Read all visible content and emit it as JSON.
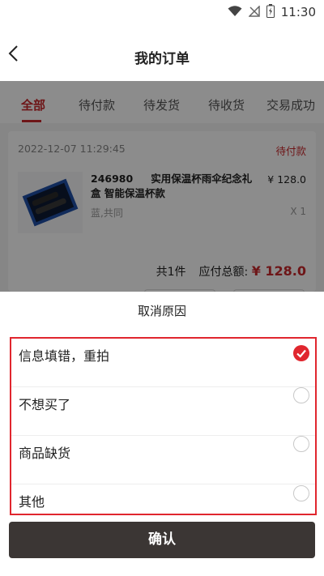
{
  "status_bar": {
    "time": "11:30",
    "icons": [
      "wifi-icon",
      "signal-off-icon",
      "battery-charging-icon"
    ]
  },
  "header": {
    "back_icon": "chevron-left-icon",
    "title": "我的订单"
  },
  "tabs": [
    {
      "label": "全部",
      "active": true
    },
    {
      "label": "待付款",
      "active": false
    },
    {
      "label": "待发货",
      "active": false
    },
    {
      "label": "待收货",
      "active": false
    },
    {
      "label": "交易成功",
      "active": false
    }
  ],
  "order": {
    "time": "2022-12-07 11:29:45",
    "status": "待付款",
    "product": {
      "code": "246980",
      "name": "实用保温杯雨伞纪念礼盒 智能保温杯款",
      "price": "¥ 128.0",
      "spec": "蓝,共同",
      "qty": "X 1"
    },
    "count": "共1件",
    "total_label": "应付总额:",
    "total_value": "¥ 128.0"
  },
  "sheet": {
    "title": "取消原因",
    "options": [
      {
        "label": "信息填错，重拍",
        "checked": true
      },
      {
        "label": "不想买了",
        "checked": false
      },
      {
        "label": "商品缺货",
        "checked": false
      },
      {
        "label": "其他",
        "checked": false
      }
    ],
    "confirm": "确认"
  },
  "colors": {
    "accent": "#c8282d",
    "highlight_border": "#e0262e",
    "confirm_bg": "#3b3634",
    "overlay": "rgba(0,0,0,0.45)"
  }
}
